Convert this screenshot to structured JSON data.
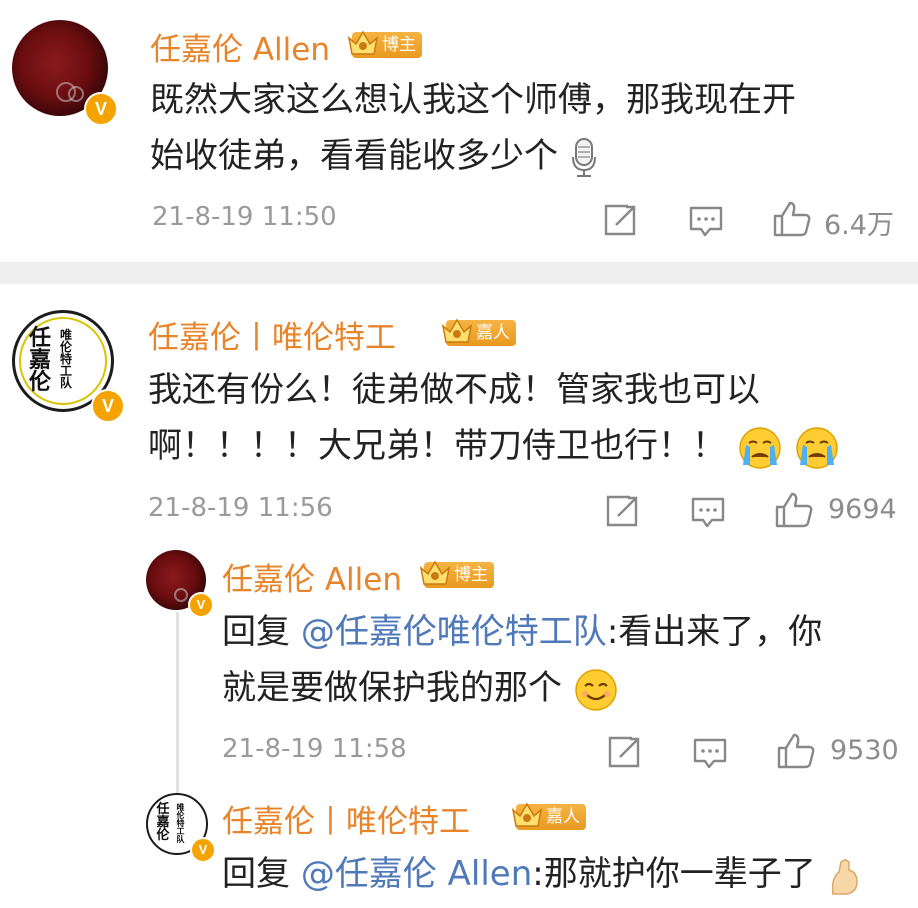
{
  "comment1": {
    "author": "任嘉伦 Allen",
    "badge": "博主",
    "text_line1": "既然大家这么想认我这个师傅，那我现在开",
    "text_line2": "始收徒弟，看看能收多少个",
    "time": "21-8-19 11:50",
    "likes": "6.4万",
    "trailing_icon": "microphone-icon"
  },
  "comment2": {
    "author": "任嘉伦丨唯伦特工",
    "badge": "嘉人",
    "text_line1": "我还有份么！徒弟做不成！管家我也可以",
    "text_line2": "啊！！！！大兄弟！带刀侍卫也行！！",
    "time": "21-8-19 11:56",
    "likes": "9694",
    "trailing_icons": [
      "crying-face-icon",
      "crying-face-icon"
    ]
  },
  "reply1": {
    "author": "任嘉伦 Allen",
    "badge": "博主",
    "reply_prefix": "回复 ",
    "mention": "@任嘉伦唯伦特工队",
    "text_line1_rest": ":看出来了，你",
    "text_line2": "就是要做保护我的那个",
    "time": "21-8-19 11:58",
    "likes": "9530",
    "trailing_icon": "smile-face-icon"
  },
  "reply2": {
    "author": "任嘉伦丨唯伦特工",
    "badge": "嘉人",
    "reply_prefix": "回复 ",
    "mention": "@任嘉伦 Allen",
    "text_rest": ":那就护你一辈子了",
    "trailing_icon": "flexed-arm-icon"
  },
  "avatar_logo_text": "任嘉伦",
  "avatar_logo_text2": "唯伦特工队",
  "verified_mark": "V",
  "colors": {
    "name": "#e8842a",
    "mention": "#4f79b8",
    "meta": "#9a9a9a",
    "badge": "#eea12b",
    "verified": "#f5a300"
  }
}
